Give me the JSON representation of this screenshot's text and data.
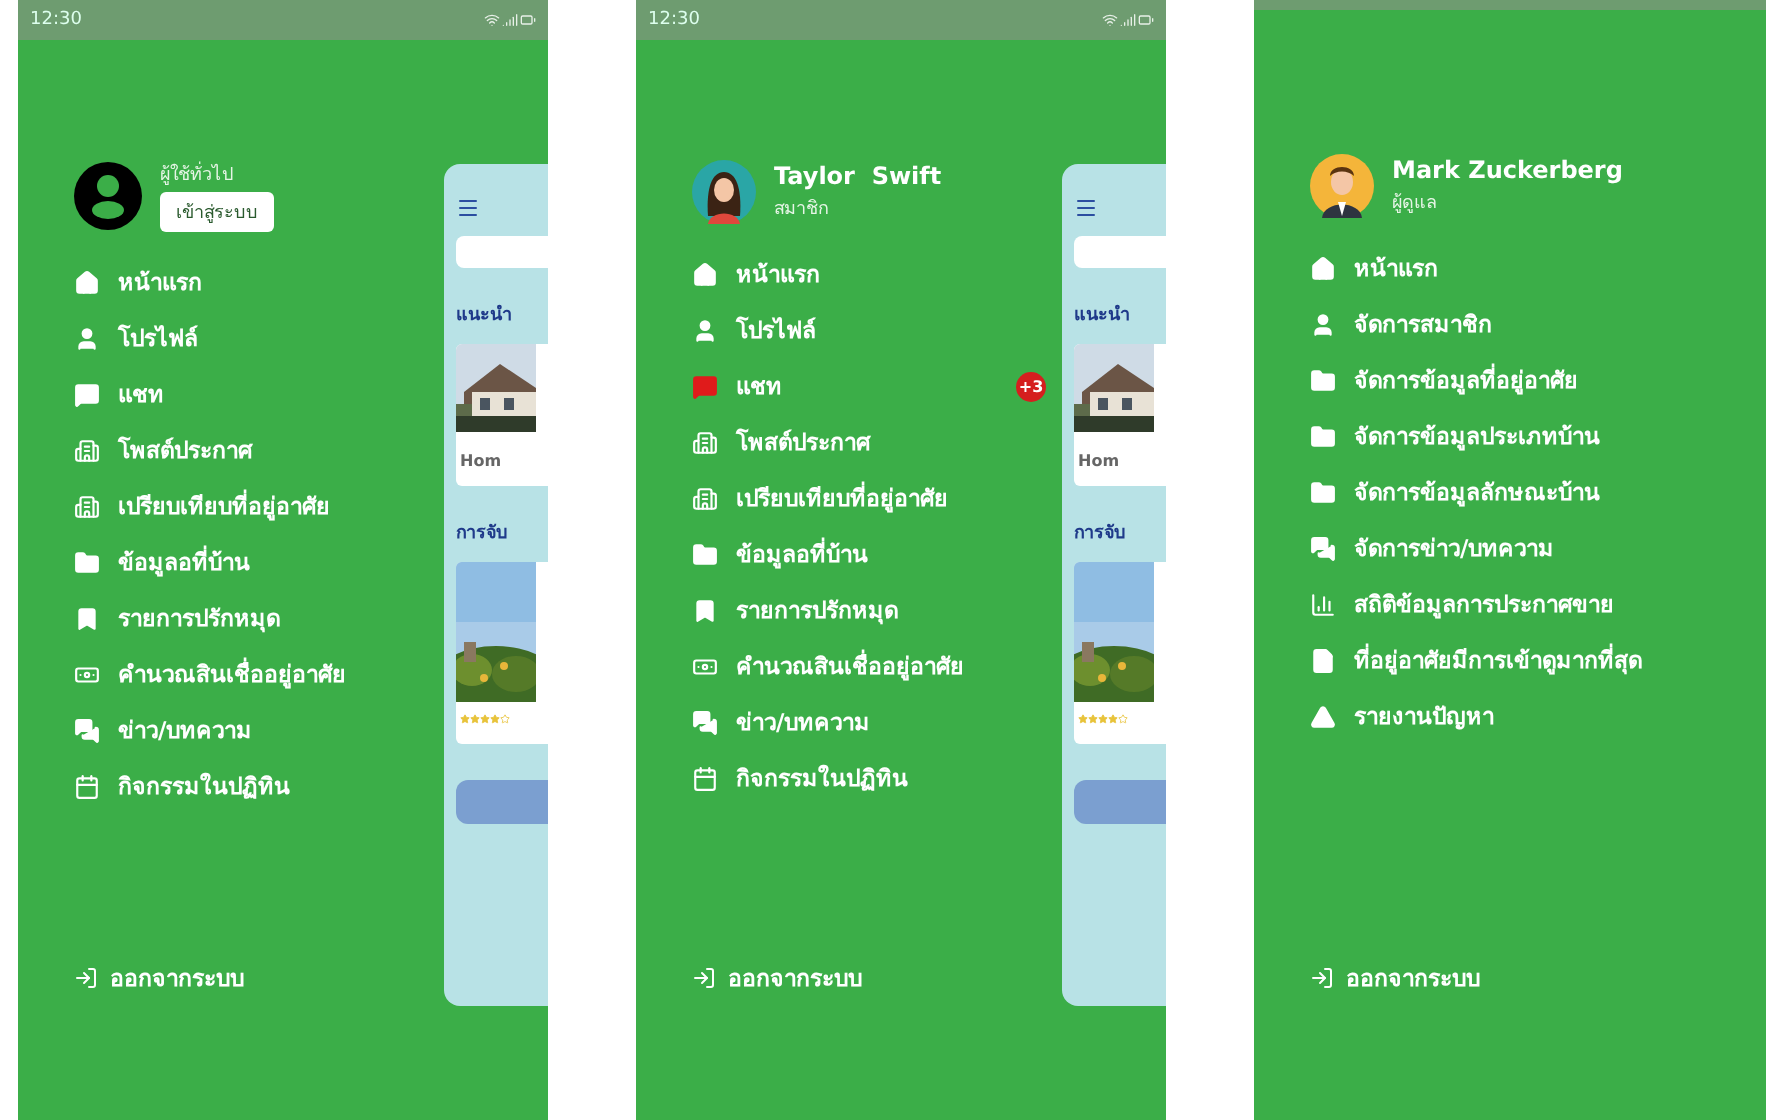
{
  "screens": [
    {
      "status_time": "12:30",
      "profile": {
        "kind": "guest",
        "role": "ผู้ใช้ทั่วไป",
        "login_button": "เข้าสู่ระบบ"
      },
      "menu": [
        {
          "kind": "home",
          "label": "หน้าแรก"
        },
        {
          "kind": "user",
          "label": "โปรไฟล์"
        },
        {
          "kind": "chat",
          "label": "แชท"
        },
        {
          "kind": "building",
          "label": "โพสต์ประกาศ"
        },
        {
          "kind": "building",
          "label": "เปรียบเทียบที่อยู่อาศัย"
        },
        {
          "kind": "folder",
          "label": "ข้อมูลอที่บ้าน"
        },
        {
          "kind": "bookmark",
          "label": "รายการปรักหมุด"
        },
        {
          "kind": "money",
          "label": "คำนวณสินเชื่ออยู่อาศัย"
        },
        {
          "kind": "news",
          "label": "ข่าว/บทความ"
        },
        {
          "kind": "calendar",
          "label": "กิจกรรมในปฏิทิน"
        }
      ],
      "logout": "ออกจากระบบ",
      "panel": {
        "section_1": "แนะนำ",
        "card_1_title": "Hom",
        "section_2": "การจับ",
        "card_2": {
          "stars": 4
        }
      }
    },
    {
      "status_time": "12:30",
      "profile": {
        "kind": "member",
        "name": "Taylor  Swift",
        "role": "สมาชิก"
      },
      "menu": [
        {
          "kind": "home",
          "label": "หน้าแรก"
        },
        {
          "kind": "user",
          "label": "โปรไฟล์"
        },
        {
          "kind": "chat",
          "label": "แชท",
          "badge": "+3"
        },
        {
          "kind": "building",
          "label": "โพสต์ประกาศ"
        },
        {
          "kind": "building",
          "label": "เปรียบเทียบที่อยู่อาศัย"
        },
        {
          "kind": "folder",
          "label": "ข้อมูลอที่บ้าน"
        },
        {
          "kind": "bookmark",
          "label": "รายการปรักหมุด"
        },
        {
          "kind": "money",
          "label": "คำนวณสินเชื่ออยู่อาศัย"
        },
        {
          "kind": "news",
          "label": "ข่าว/บทความ"
        },
        {
          "kind": "calendar",
          "label": "กิจกรรมในปฏิทิน"
        }
      ],
      "logout": "ออกจากระบบ",
      "panel": {
        "section_1": "แนะนำ",
        "card_1_title": "Hom",
        "section_2": "การจับ",
        "card_2": {
          "stars": 4
        }
      }
    },
    {
      "profile": {
        "kind": "admin",
        "name": "Mark Zuckerberg",
        "role": "ผู้ดูแล"
      },
      "menu": [
        {
          "kind": "home",
          "label": "หน้าแรก"
        },
        {
          "kind": "user",
          "label": "จัดการสมาชิก"
        },
        {
          "kind": "folder",
          "label": "จัดการข้อมูลที่อยู่อาศัย"
        },
        {
          "kind": "folder",
          "label": "จัดการข้อมูลประเภทบ้าน"
        },
        {
          "kind": "folder",
          "label": "จัดการข้อมูลลักษณะบ้าน"
        },
        {
          "kind": "news",
          "label": "จัดการข่าว/บทความ"
        },
        {
          "kind": "chart",
          "label": "สถิติข้อมูลการประกาศขาย"
        },
        {
          "kind": "file",
          "label": "ที่อยู่อาศัยมีการเข้าดูมากที่สุด"
        },
        {
          "kind": "warning",
          "label": "รายงานปัญหา"
        }
      ],
      "logout": "ออกจากระบบ"
    }
  ]
}
